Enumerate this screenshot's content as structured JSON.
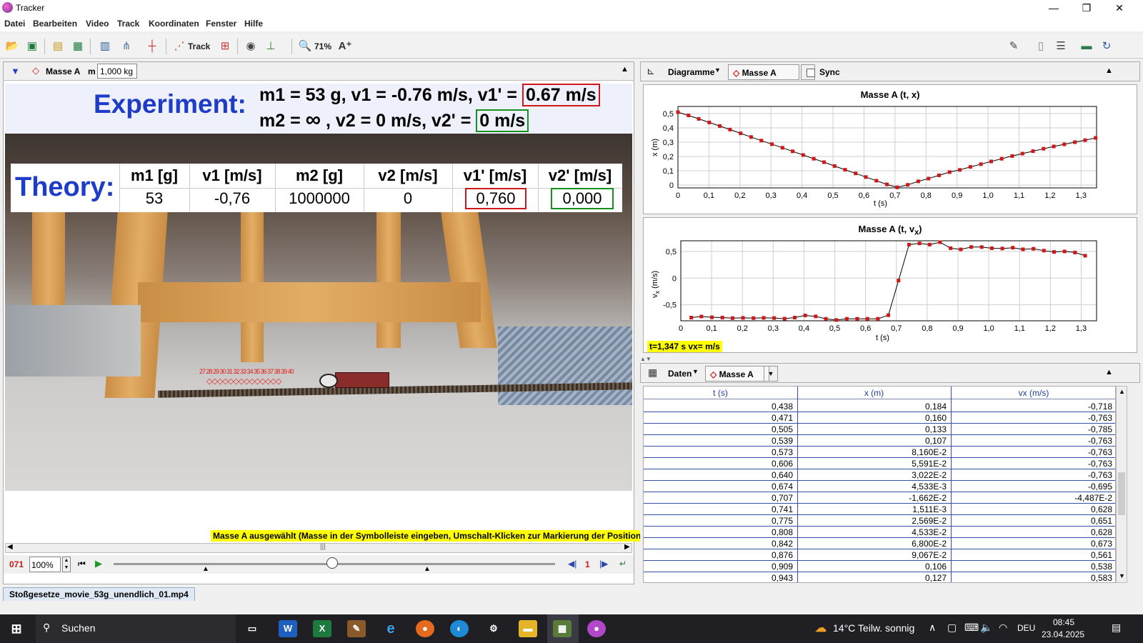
{
  "window": {
    "title": "Tracker",
    "minimize": "—",
    "maximize": "❐",
    "close": "✕"
  },
  "menu": [
    "Datei",
    "Bearbeiten",
    "Video",
    "Track",
    "Koordinaten",
    "Fenster",
    "Hilfe"
  ],
  "toolbar": {
    "track_label": "Track",
    "zoom_label": "71%"
  },
  "trackbar": {
    "track_name": "Masse A",
    "mass_label": "m",
    "mass_value": "1,000 kg"
  },
  "video": {
    "experiment_title": "Experiment:",
    "eq1_prefix": "m1 = 53 g, v1 = -0.76 m/s, v1' =",
    "eq1_boxed": "0.67 m/s",
    "eq2_prefix": "m2 =",
    "eq2_infinity": "∞",
    "eq2_mid": ", v2 = 0 m/s, v2' =",
    "eq2_boxed": "0 m/s",
    "theory_title": "Theory:",
    "theory_headers": [
      "m1 [g]",
      "v1 [m/s]",
      "m2 [g]",
      "v2 [m/s]",
      "v1' [m/s]",
      "v2' [m/s]"
    ],
    "theory_values": [
      "53",
      "-0,76",
      "1000000",
      "0",
      "0,760",
      "0,000"
    ],
    "marker_labels": "27 28 29 30 31 32 33 34 35 36 37 38 39 40"
  },
  "status_message": "Masse A ausgewählt (Masse in der Symbolleiste eingeben, Umschalt-Klicken zur Markierung der Position)",
  "player": {
    "frame": "071",
    "zoom": "100%",
    "step": "1"
  },
  "file_tab": "Stoßgesetze_movie_53g_unendlich_01.mp4",
  "plots_header": {
    "view": "Diagramme",
    "track": "Masse A",
    "sync": "Sync"
  },
  "chart_data": [
    {
      "type": "scatter",
      "title": "Masse A (t, x)",
      "xlabel": "t (s)",
      "ylabel": "x (m)",
      "xlim": [
        0,
        1.35
      ],
      "ylim": [
        -0.02,
        0.55
      ],
      "xticks": [
        "0",
        "0,1",
        "0,2",
        "0,3",
        "0,4",
        "0,5",
        "0,6",
        "0,7",
        "0,8",
        "0,9",
        "1,0",
        "1,1",
        "1,2",
        "1,3"
      ],
      "yticks": [
        "0",
        "0,1",
        "0,2",
        "0,3",
        "0,4",
        "0,5"
      ],
      "x": [
        0.0,
        0.034,
        0.067,
        0.101,
        0.135,
        0.168,
        0.202,
        0.236,
        0.269,
        0.303,
        0.337,
        0.37,
        0.404,
        0.438,
        0.471,
        0.505,
        0.539,
        0.573,
        0.606,
        0.64,
        0.674,
        0.707,
        0.741,
        0.775,
        0.808,
        0.842,
        0.876,
        0.909,
        0.943,
        0.977,
        1.01,
        1.044,
        1.078,
        1.111,
        1.145,
        1.179,
        1.212,
        1.246,
        1.28,
        1.313,
        1.347
      ],
      "y": [
        0.51,
        0.487,
        0.463,
        0.438,
        0.413,
        0.388,
        0.362,
        0.336,
        0.311,
        0.286,
        0.261,
        0.236,
        0.21,
        0.184,
        0.16,
        0.133,
        0.107,
        0.0816,
        0.0559,
        0.0302,
        0.00453,
        -0.0166,
        0.00151,
        0.0257,
        0.0453,
        0.068,
        0.0907,
        0.106,
        0.127,
        0.146,
        0.165,
        0.184,
        0.203,
        0.22,
        0.237,
        0.254,
        0.27,
        0.285,
        0.3,
        0.314,
        0.33
      ]
    },
    {
      "type": "scatter",
      "title": "Masse A (t, vx)",
      "title_base": "Masse A (t, v",
      "title_sub": "x",
      "title_end": ")",
      "xlabel": "t (s)",
      "ylabel_base": "v",
      "ylabel_sub": "x",
      "ylabel_unit": " (m/s)",
      "xlim": [
        0,
        1.35
      ],
      "ylim": [
        -0.8,
        0.7
      ],
      "xticks": [
        "0",
        "0,1",
        "0,2",
        "0,3",
        "0,4",
        "0,5",
        "0,6",
        "0,7",
        "0,8",
        "0,9",
        "1,0",
        "1,1",
        "1,2",
        "1,3"
      ],
      "yticks": [
        "-0,5",
        "0",
        "0,5"
      ],
      "x": [
        0.034,
        0.067,
        0.101,
        0.135,
        0.168,
        0.202,
        0.236,
        0.269,
        0.303,
        0.337,
        0.37,
        0.404,
        0.438,
        0.471,
        0.505,
        0.539,
        0.573,
        0.606,
        0.64,
        0.674,
        0.707,
        0.741,
        0.775,
        0.808,
        0.842,
        0.876,
        0.909,
        0.943,
        0.977,
        1.01,
        1.044,
        1.078,
        1.111,
        1.145,
        1.179,
        1.212,
        1.246,
        1.28,
        1.313
      ],
      "y": [
        -0.74,
        -0.72,
        -0.735,
        -0.74,
        -0.75,
        -0.745,
        -0.75,
        -0.745,
        -0.748,
        -0.76,
        -0.74,
        -0.7,
        -0.718,
        -0.763,
        -0.785,
        -0.763,
        -0.763,
        -0.763,
        -0.763,
        -0.695,
        -0.0449,
        0.628,
        0.651,
        0.628,
        0.673,
        0.561,
        0.538,
        0.583,
        0.582,
        0.56,
        0.555,
        0.57,
        0.54,
        0.55,
        0.515,
        0.49,
        0.5,
        0.48,
        0.42
      ]
    }
  ],
  "readout": "t=1,347 s  vx= m/s",
  "data_header": {
    "view": "Daten",
    "track": "Masse A"
  },
  "table": {
    "columns": [
      "t (s)",
      "x (m)",
      "vx (m/s)"
    ],
    "rows": [
      [
        "0,438",
        "0,184",
        "-0,718"
      ],
      [
        "0,471",
        "0,160",
        "-0,763"
      ],
      [
        "0,505",
        "0,133",
        "-0,785"
      ],
      [
        "0,539",
        "0,107",
        "-0,763"
      ],
      [
        "0,573",
        "8,160E-2",
        "-0,763"
      ],
      [
        "0,606",
        "5,591E-2",
        "-0,763"
      ],
      [
        "0,640",
        "3,022E-2",
        "-0,763"
      ],
      [
        "0,674",
        "4,533E-3",
        "-0,695"
      ],
      [
        "0,707",
        "-1,662E-2",
        "-4,487E-2"
      ],
      [
        "0,741",
        "1,511E-3",
        "0,628"
      ],
      [
        "0,775",
        "2,569E-2",
        "0,651"
      ],
      [
        "0,808",
        "4,533E-2",
        "0,628"
      ],
      [
        "0,842",
        "6,800E-2",
        "0,673"
      ],
      [
        "0,876",
        "9,067E-2",
        "0,561"
      ],
      [
        "0,909",
        "0,106",
        "0,538"
      ],
      [
        "0,943",
        "0,127",
        "0,583"
      ]
    ]
  },
  "taskbar": {
    "search": "Suchen",
    "weather": "14°C  Teilw. sonnig",
    "lang": "DEU",
    "time": "08:45",
    "date": "23.04.2025"
  },
  "colors": {
    "accent_blue": "#1e3cc8",
    "box_red": "#d01818",
    "box_green": "#16901e",
    "highlight": "#ffff00",
    "plot_point": "#d01818"
  }
}
